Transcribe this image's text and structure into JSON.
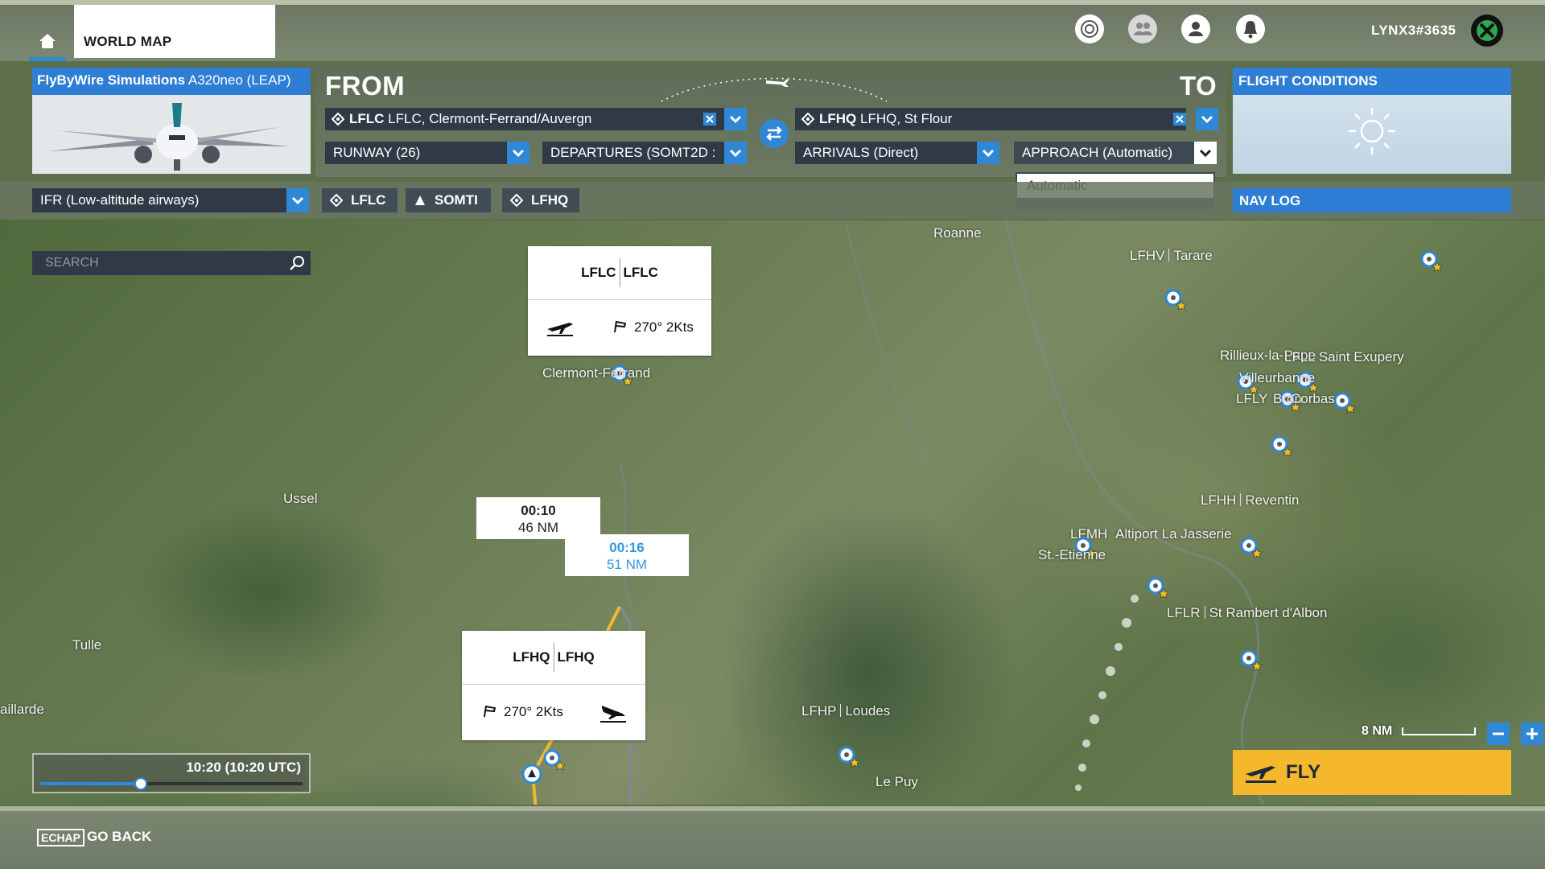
{
  "header": {
    "tab_world_map": "WORLD MAP",
    "username": "LYNX3#3635",
    "icons": [
      "home-icon",
      "activity-icon",
      "friends-icon",
      "profile-icon",
      "notifications-icon",
      "xbox-icon"
    ]
  },
  "aircraft": {
    "brand": "FlyByWire Simulations",
    "model": "A320neo (LEAP)"
  },
  "route": {
    "from_label": "FROM",
    "to_label": "TO",
    "departure": {
      "code": "LFLC",
      "name": "LFLC, Clermont-Ferrand/Auvergn"
    },
    "arrival": {
      "code": "LFHQ",
      "name": "LFHQ, St Flour"
    },
    "runway": "RUNWAY (26)",
    "departures": "DEPARTURES (SOMT2D :",
    "arrivals": "ARRIVALS (Direct)",
    "approach": "APPROACH (Automatic)",
    "approach_options": [
      "Automatic"
    ]
  },
  "conditions": {
    "title": "FLIGHT CONDITIONS",
    "weather_icon": "sun-icon"
  },
  "flight_plan": {
    "type": "IFR (Low-altitude airways)",
    "waypoints": [
      "LFLC",
      "SOMTI",
      "LFHQ"
    ]
  },
  "nav_log": "NAV LOG",
  "search": {
    "placeholder": "SEARCH"
  },
  "map": {
    "departure_card": {
      "code_a": "LFLC",
      "code_b": "LFLC",
      "wind": "270° 2Kts"
    },
    "arrival_card": {
      "code_a": "LFHQ",
      "code_b": "LFHQ",
      "wind": "270° 2Kts"
    },
    "leg_primary": {
      "time": "00:10",
      "distance": "46 NM"
    },
    "leg_alternate": {
      "time": "00:16",
      "distance": "51 NM"
    },
    "labels": {
      "roanne": "Roanne",
      "clermont": "Clermont-Ferrand",
      "ussel": "Ussel",
      "tulle": "Tulle",
      "aillarde": "aillarde",
      "lfhv_code": "LFHV",
      "lfhv_name": "Tarare",
      "rillieux": "Rillieux-la-Pape",
      "villeurbanne": "Villeurbanne",
      "saint_exupery": "LFLL Saint Exupery",
      "lfly": "LFLY",
      "bron": "Bron",
      "corbas": "Corbas",
      "lfhh_code": "LFHH",
      "lfhh_name": "Reventin",
      "lfmh_code": "LFMH",
      "lfmh_name": "St.-Etienne",
      "jasserie": "Altiport La Jasserie",
      "lflr_code": "LFLR",
      "lflr_name": "St Rambert d'Albon",
      "lfhp_code": "LFHP",
      "lfhp_name": "Loudes",
      "le_puy": "Le Puy"
    },
    "scale": "8 NM"
  },
  "time": {
    "label": "10:20 (10:20 UTC)",
    "position": 0.38
  },
  "fly_label": "FLY",
  "bottom": {
    "key": "ECHAP",
    "action": "GO BACK"
  },
  "colors": {
    "accent": "#2f88d6",
    "panel_blue": "#2e7ed6",
    "route_primary": "#f0b830",
    "route_alternate": "#808890",
    "fly_button": "#f5b72c"
  }
}
